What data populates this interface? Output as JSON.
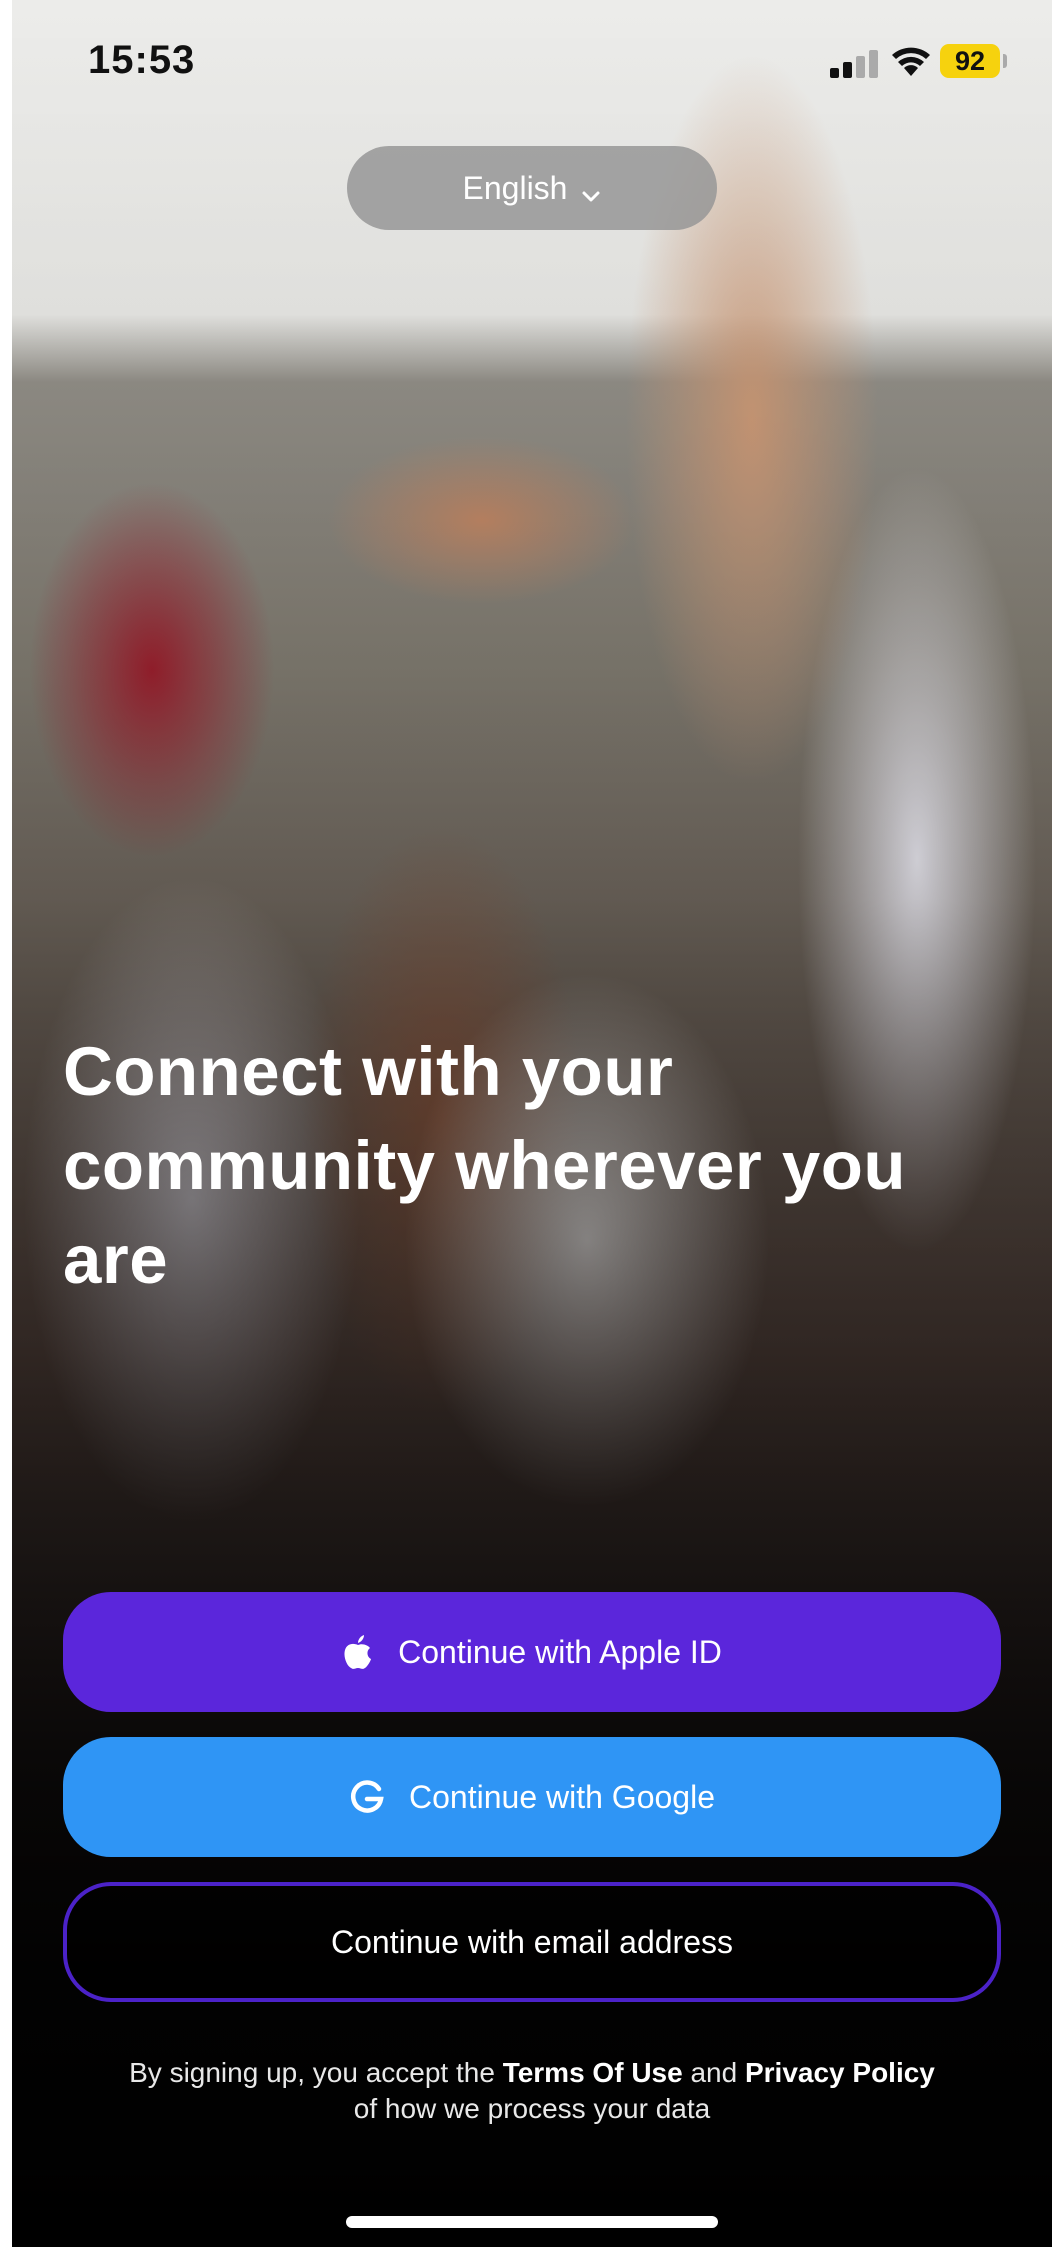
{
  "status_bar": {
    "time": "15:53",
    "battery": "92",
    "signal_icon": "cellular-signal-icon",
    "wifi_icon": "wifi-icon",
    "battery_color": "#f6d20e"
  },
  "language": {
    "label": "English",
    "icon": "chevron-down-icon"
  },
  "headline": {
    "line1": "Connect with your",
    "line2": "community wherever you",
    "line3": "are"
  },
  "buttons": {
    "apple": {
      "label": "Continue with Apple ID",
      "icon": "apple-icon",
      "color": "#5b26db"
    },
    "google": {
      "label": "Continue with Google",
      "icon": "google-icon",
      "color": "#2f95f5"
    },
    "email": {
      "label": "Continue with email address",
      "border_color": "#4b22c8"
    }
  },
  "legal": {
    "prefix": "By signing up, you accept the",
    "terms": "Terms Of Use",
    "and": "and",
    "privacy": "Privacy Policy",
    "suffix": "of how we process your data"
  }
}
